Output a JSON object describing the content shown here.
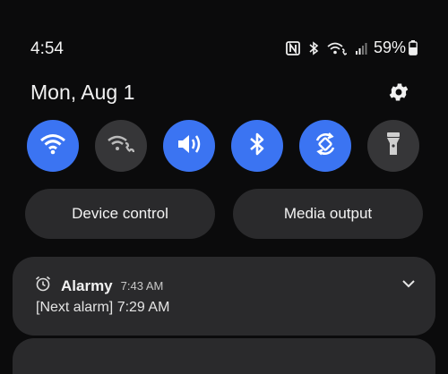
{
  "status_bar": {
    "time": "4:54",
    "battery_percent": "59%",
    "icons": [
      "nfc-icon",
      "bluetooth-icon",
      "wifi-calling-icon",
      "signal-icon",
      "battery-icon"
    ]
  },
  "header": {
    "date": "Mon, Aug 1",
    "settings_icon": "gear-icon"
  },
  "quick_settings": [
    {
      "name": "wifi",
      "icon": "wifi-icon",
      "state": "on"
    },
    {
      "name": "wifi-calling",
      "icon": "wifi-calling-icon",
      "state": "off"
    },
    {
      "name": "sound",
      "icon": "speaker-icon",
      "state": "on"
    },
    {
      "name": "bluetooth",
      "icon": "bluetooth-icon",
      "state": "on"
    },
    {
      "name": "auto-rotate",
      "icon": "rotate-icon",
      "state": "on"
    },
    {
      "name": "flashlight",
      "icon": "flashlight-icon",
      "state": "off"
    }
  ],
  "buttons": {
    "device_control": "Device control",
    "media_output": "Media output"
  },
  "notification": {
    "app": "Alarmy",
    "time": "7:43 AM",
    "body": "[Next alarm] 7:29 AM",
    "icon": "alarm-clock-icon"
  },
  "colors": {
    "background": "#0b0b0c",
    "tile_on": "#3b74f2",
    "tile_off": "#363638",
    "card": "#2a2a2c"
  }
}
